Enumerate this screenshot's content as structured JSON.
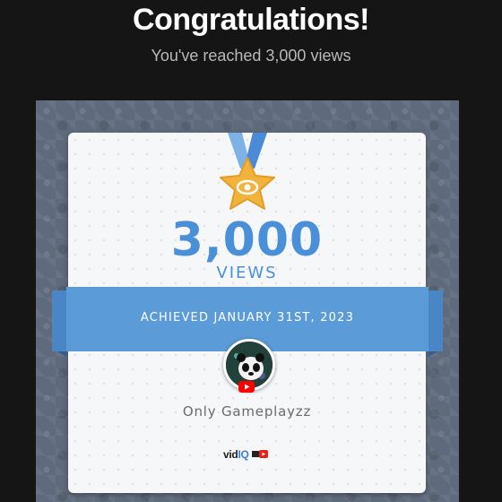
{
  "header": {
    "title": "Congratulations!",
    "subtitle": "You've reached 3,000 views"
  },
  "milestone": {
    "count": "3,000",
    "unit": "VIEWS",
    "achieved": "ACHIEVED JANUARY 31ST, 2023"
  },
  "channel": {
    "name": "Only Gameplayzz",
    "platform_icon": "youtube-icon"
  },
  "brand": {
    "logo_prefix": "vid",
    "logo_suffix": "IQ"
  },
  "colors": {
    "accent_blue": "#4a90d9",
    "ribbon_blue": "#5b9bd8",
    "medal_gold": "#f2b33d",
    "background": "#151515"
  }
}
